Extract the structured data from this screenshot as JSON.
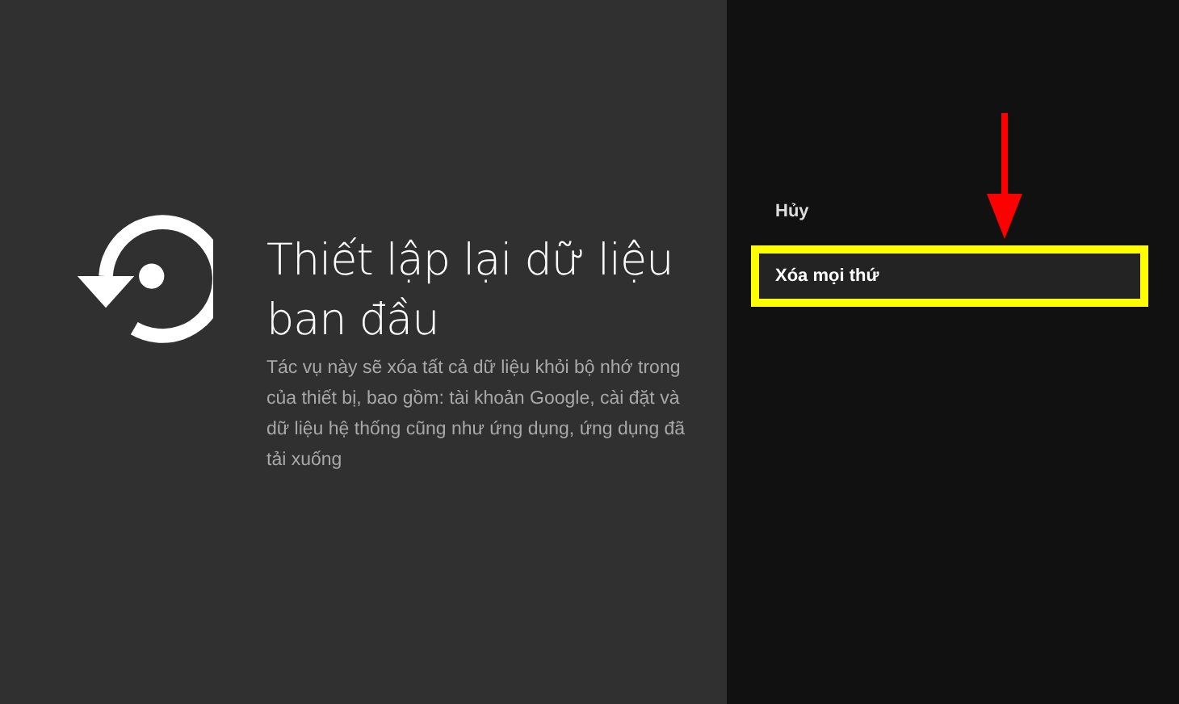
{
  "title": "Thiết lập lại dữ liệu ban đầu",
  "description": "Tác vụ này sẽ xóa tất cả dữ liệu khỏi bộ nhớ trong của thiết bị, bao gồm: tài khoản Google, cài đặt và dữ liệu hệ thống cũng như ứng dụng, ứng dụng đã tải xuống",
  "actions": [
    {
      "label": "Hủy",
      "selected": false,
      "highlighted": false
    },
    {
      "label": "Xóa mọi thứ",
      "selected": true,
      "highlighted": true
    }
  ],
  "annotations": [
    {
      "kind": "arrow"
    }
  ]
}
